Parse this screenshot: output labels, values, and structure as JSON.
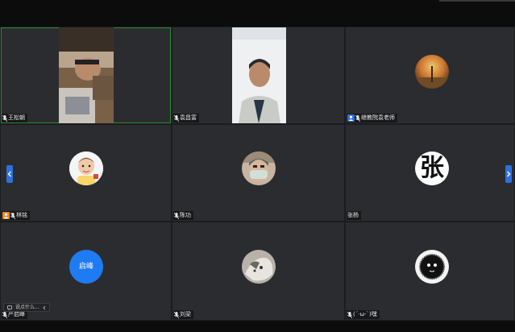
{
  "participants": [
    {
      "name": "王松朝",
      "badge": "none",
      "video": "camera"
    },
    {
      "name": "袁昌富",
      "badge": "none",
      "video": "camera"
    },
    {
      "name": "继教院袁老师",
      "badge": "host",
      "video": "off"
    },
    {
      "name": "林铭",
      "badge": "cohost",
      "video": "off"
    },
    {
      "name": "陈功",
      "badge": "none",
      "video": "off"
    },
    {
      "name": "张杨",
      "badge": "none",
      "video": "off"
    },
    {
      "name": "严启峰",
      "badge": "none",
      "video": "off"
    },
    {
      "name": "刘梁",
      "badge": "none",
      "video": "off"
    },
    {
      "name": "(´·ω·`)嘿",
      "badge": "none",
      "video": "off"
    }
  ],
  "avatars": {
    "zhang_char": "张",
    "yan_text": "启峰"
  },
  "pill": {
    "text": "说点什么..."
  },
  "colors": {
    "tile_bg": "#2b2c2f",
    "active_border": "#2f8a3a",
    "accent_blue": "#2d6fe0",
    "cohost_orange": "#e8892a"
  },
  "icons": {
    "mic": "mic-muted-icon",
    "pager_left": "chevron-left-icon",
    "pager_right": "chevron-right-icon",
    "pill": "chat-icon"
  }
}
